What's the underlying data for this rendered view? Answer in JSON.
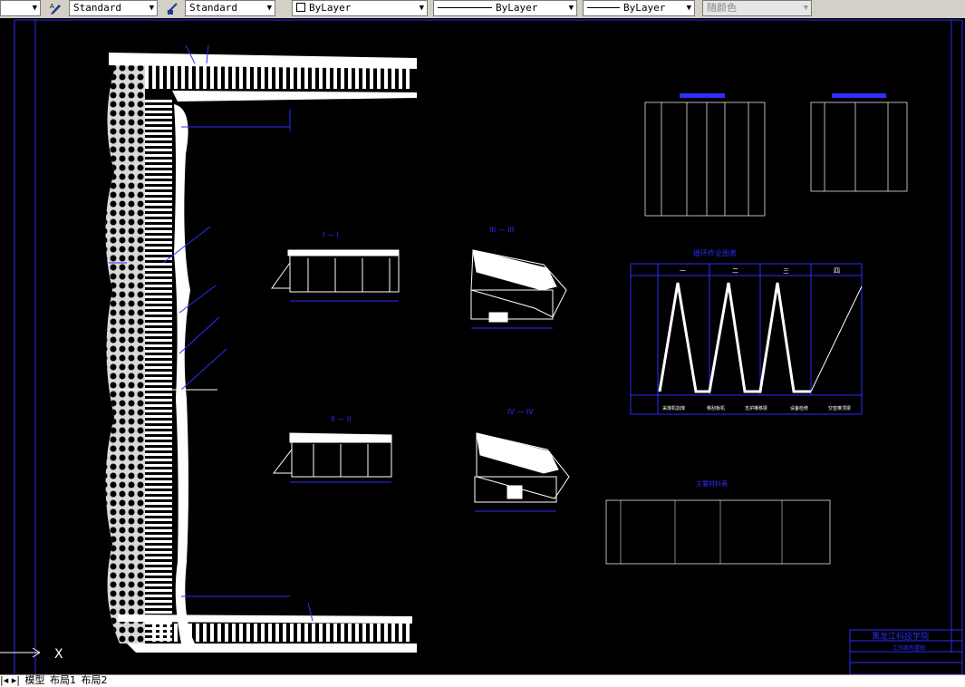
{
  "toolbar": {
    "text_style": "Standard",
    "dim_style": "Standard",
    "layer": "ByLayer",
    "linetype": "ByLayer",
    "lineweight": "ByLayer",
    "plot_style": "随颜色"
  },
  "tabs": {
    "model": "模型",
    "layout1": "布局1",
    "layout2": "布局2"
  },
  "drawing": {
    "section_1": "I — I",
    "section_2": "II — II",
    "section_3": "III — III",
    "section_4": "IV — IV",
    "cycle_title": "循环作业图表",
    "materials_title": "主要材料表",
    "cycle_cols": [
      "一",
      "二",
      "三",
      "四"
    ],
    "cycle_legend": [
      "采煤机割煤",
      "移刮板机",
      "支护推移梁",
      "设备检修",
      "交替推顶梁"
    ],
    "title_block": "黑龙江科技学院",
    "title_block_sub": "工作面布置图",
    "coord_x": "X"
  },
  "colors": {
    "cad_background": "#000000",
    "annotation_blue": "#0000ff",
    "line_white": "#ffffff",
    "toolbar_gray": "#d4d0c8"
  }
}
